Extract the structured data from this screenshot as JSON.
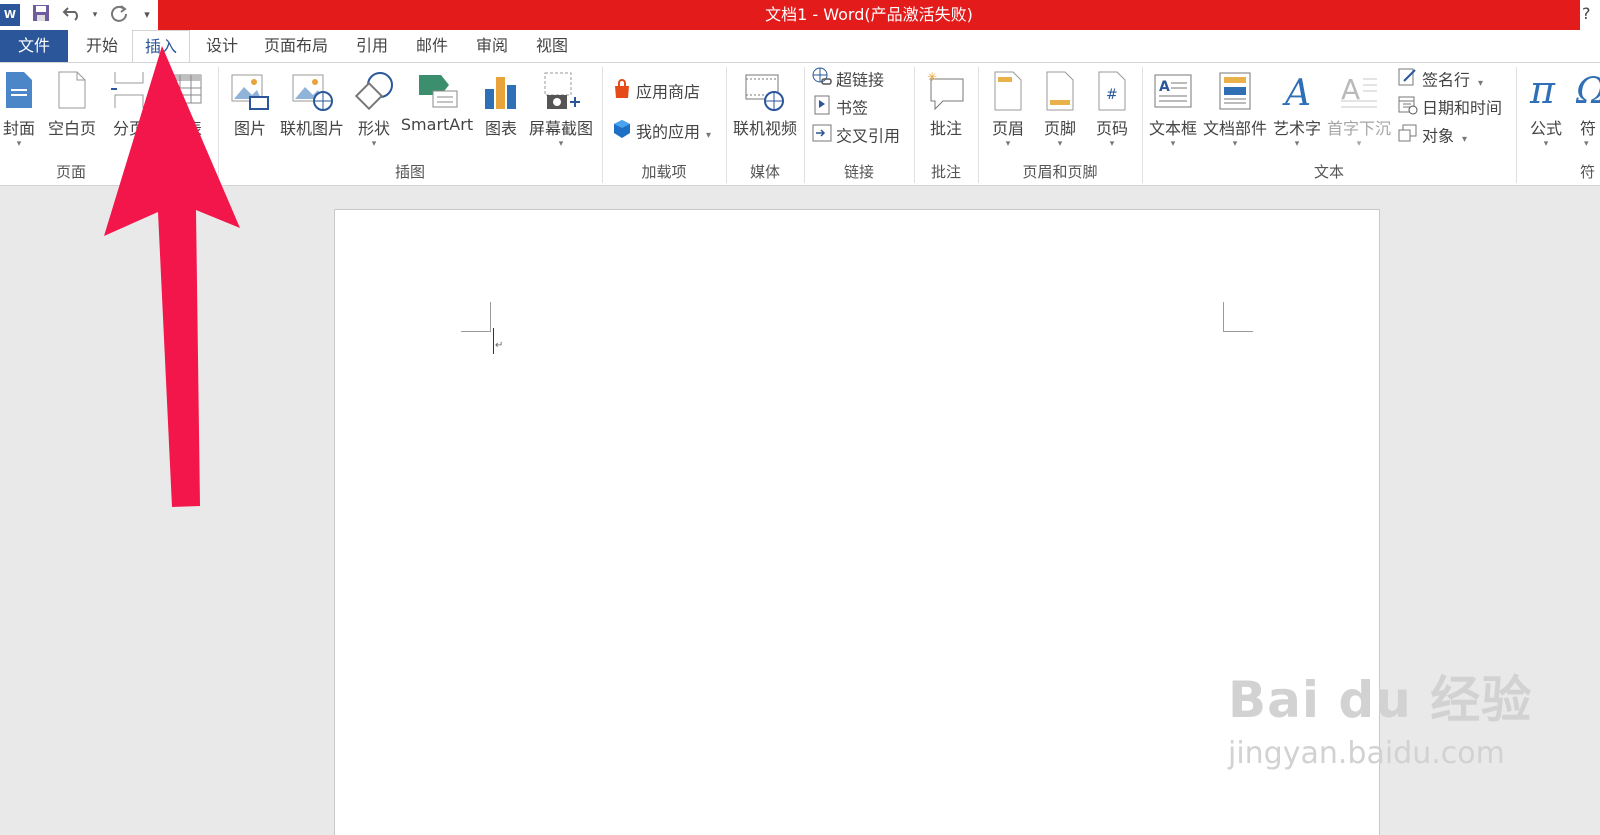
{
  "window": {
    "title": "文档1 -  Word(产品激活失败)",
    "help": "?"
  },
  "quick_access": {
    "word_logo": "W",
    "icons": [
      "save-icon",
      "undo-icon",
      "redo-icon",
      "customize-icon"
    ]
  },
  "tabs": [
    "文件",
    "开始",
    "插入",
    "设计",
    "页面布局",
    "引用",
    "邮件",
    "审阅",
    "视图"
  ],
  "active_tab": "插入",
  "ribbon": {
    "pages": {
      "label": "页面",
      "buttons": [
        "封面",
        "空白页",
        "分页"
      ],
      "partial": "表"
    },
    "illustrations": {
      "label": "插图",
      "buttons": [
        "图片",
        "联机图片",
        "形状",
        "SmartArt",
        "图表",
        "屏幕截图"
      ]
    },
    "addins": {
      "label": "加载项",
      "items": [
        "应用商店",
        "我的应用"
      ]
    },
    "media": {
      "label": "媒体",
      "buttons": [
        "联机视频"
      ]
    },
    "links": {
      "label": "链接",
      "items": [
        "超链接",
        "书签",
        "交叉引用"
      ]
    },
    "comments": {
      "label": "批注",
      "buttons": [
        "批注"
      ]
    },
    "header_footer": {
      "label": "页眉和页脚",
      "buttons": [
        "页眉",
        "页脚",
        "页码"
      ]
    },
    "text": {
      "label": "文本",
      "buttons": [
        "文本框",
        "文档部件",
        "艺术字",
        "首字下沉"
      ],
      "small": [
        "签名行",
        "日期和时间",
        "对象"
      ]
    },
    "symbols": {
      "label": "符",
      "buttons": [
        "公式",
        "符"
      ]
    }
  },
  "watermark": {
    "brand": "Bai du 经验",
    "url": "jingyan.baidu.com"
  },
  "colors": {
    "title_bar": "#e31b1b",
    "file_tab": "#2b579a",
    "arrow": "#f2164a"
  }
}
